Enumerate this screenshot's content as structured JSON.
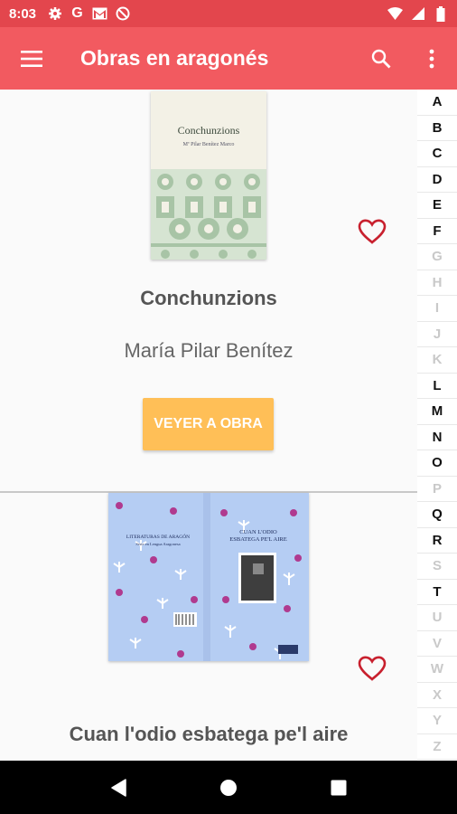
{
  "status_bar": {
    "time": "8:03",
    "left_icons": [
      "gear-icon",
      "google-icon",
      "gmail-icon",
      "no-data-icon"
    ],
    "right_icons": [
      "wifi-icon",
      "signal-icon",
      "battery-icon"
    ]
  },
  "app_bar": {
    "title": "Obras en aragonés",
    "color": "#f25a60",
    "status_color": "#e3464d"
  },
  "books": [
    {
      "title": "Conchunzions",
      "author": "María Pilar Benítez",
      "cover_title": "Conchunzions",
      "cover_author": "Mª Pilar Benítez Marco",
      "button_label": "VEYER A OBRA",
      "favorite": false
    },
    {
      "title": "Cuan l'odio esbatega pe'l aire",
      "cover_series": "LITERATURAS DE ARAGÓN",
      "cover_series_sub": "Serie en Lengua Aragonesa",
      "cover_spine_title": "CUAN L'ODIO ESBATEGA PE'L AIRE",
      "favorite": false
    }
  ],
  "alphabet": [
    {
      "letter": "A",
      "enabled": true
    },
    {
      "letter": "B",
      "enabled": true
    },
    {
      "letter": "C",
      "enabled": true
    },
    {
      "letter": "D",
      "enabled": true
    },
    {
      "letter": "E",
      "enabled": true
    },
    {
      "letter": "F",
      "enabled": true
    },
    {
      "letter": "G",
      "enabled": false
    },
    {
      "letter": "H",
      "enabled": false
    },
    {
      "letter": "I",
      "enabled": false
    },
    {
      "letter": "J",
      "enabled": false
    },
    {
      "letter": "K",
      "enabled": false
    },
    {
      "letter": "L",
      "enabled": true
    },
    {
      "letter": "M",
      "enabled": true
    },
    {
      "letter": "N",
      "enabled": true
    },
    {
      "letter": "O",
      "enabled": true
    },
    {
      "letter": "P",
      "enabled": false
    },
    {
      "letter": "Q",
      "enabled": true
    },
    {
      "letter": "R",
      "enabled": true
    },
    {
      "letter": "S",
      "enabled": false
    },
    {
      "letter": "T",
      "enabled": true
    },
    {
      "letter": "U",
      "enabled": false
    },
    {
      "letter": "V",
      "enabled": false
    },
    {
      "letter": "W",
      "enabled": false
    },
    {
      "letter": "X",
      "enabled": false
    },
    {
      "letter": "Y",
      "enabled": false
    },
    {
      "letter": "Z",
      "enabled": false
    }
  ],
  "colors": {
    "accent": "#f25a60",
    "button": "#ffbf57",
    "heart": "#c8202e"
  }
}
